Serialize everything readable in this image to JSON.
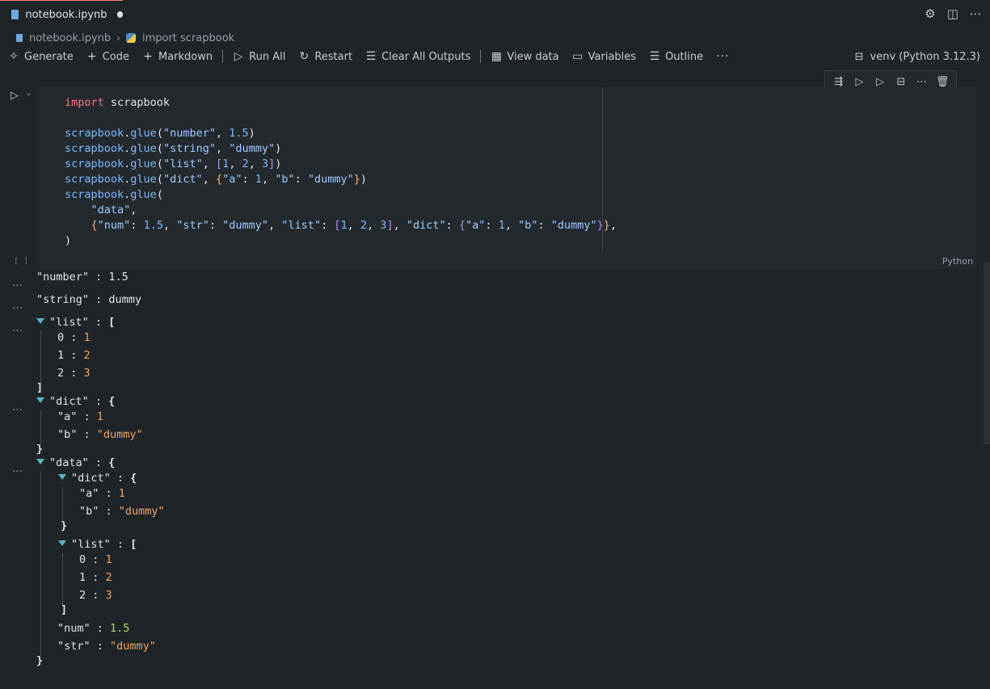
{
  "tab": {
    "label": "notebook.ipynb"
  },
  "breadcrumb": {
    "file": "notebook.ipynb",
    "cell": "import scrapbook"
  },
  "toolbar": {
    "generate": "Generate",
    "code": "Code",
    "markdown": "Markdown",
    "run_all": "Run All",
    "restart": "Restart",
    "clear_all_outputs": "Clear All Outputs",
    "view_data": "View data",
    "variables": "Variables",
    "outline": "Outline",
    "more": "···",
    "kernel": "venv (Python 3.12.3)"
  },
  "cell": {
    "exec_count": "[ ]",
    "language": "Python",
    "code_lines": [
      "import scrapbook",
      "",
      "scrapbook.glue(\"number\", 1.5)",
      "scrapbook.glue(\"string\", \"dummy\")",
      "scrapbook.glue(\"list\", [1, 2, 3])",
      "scrapbook.glue(\"dict\", {\"a\": 1, \"b\": \"dummy\"})",
      "scrapbook.glue(",
      "    \"data\",",
      "    {\"num\": 1.5, \"str\": \"dummy\", \"list\": [1, 2, 3], \"dict\": {\"a\": 1, \"b\": \"dummy\"}},",
      ")"
    ]
  },
  "outputs": {
    "number_key": "\"number\"",
    "number_val": "1.5",
    "string_key": "\"string\"",
    "string_val": "dummy",
    "list_key": "\"list\"",
    "list_items": [
      {
        "i": "0",
        "v": "1"
      },
      {
        "i": "1",
        "v": "2"
      },
      {
        "i": "2",
        "v": "3"
      }
    ],
    "dict_key": "\"dict\"",
    "dict_a_key": "\"a\"",
    "dict_a_val": "1",
    "dict_b_key": "\"b\"",
    "dict_b_val": "\"dummy\"",
    "data_key": "\"data\"",
    "data_dict_key": "\"dict\"",
    "data_list_key": "\"list\"",
    "data_num_key": "\"num\"",
    "data_num_val": "1.5",
    "data_str_key": "\"str\"",
    "data_str_val": "\"dummy\"",
    "sep": " : ",
    "open_brace": "{",
    "close_brace": "}",
    "open_bracket": "[",
    "close_bracket": "]"
  }
}
